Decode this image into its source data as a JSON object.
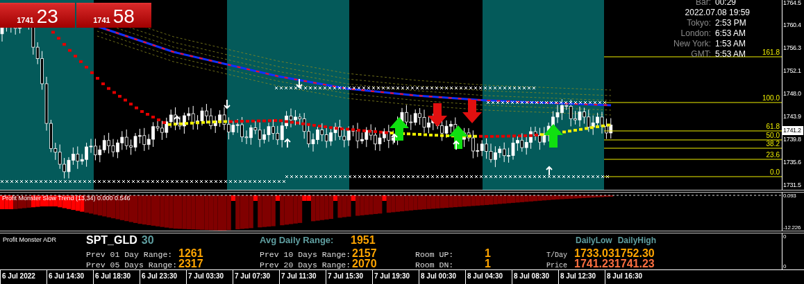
{
  "quote_boxes": [
    {
      "big_figure": "1741",
      "pips": "23"
    },
    {
      "big_figure": "1741",
      "pips": "58"
    }
  ],
  "info_panel": [
    {
      "label": "Bar:",
      "value": "00:29"
    },
    {
      "value": "2022.07.08 19:59"
    },
    {
      "label": "Tokyo:",
      "value": "2:53 PM"
    },
    {
      "label": "London:",
      "value": "6:53 AM"
    },
    {
      "label": "New York:",
      "value": "1:53 AM"
    },
    {
      "label": "GMT:",
      "value": "5:53 AM"
    }
  ],
  "fib_levels": [
    "161.8",
    "100.0",
    "61.8",
    "50.0",
    "38.2",
    "23.6",
    "0.0"
  ],
  "price_axis": [
    {
      "label": "1764.5",
      "highlighted": false
    },
    {
      "label": "1760.4",
      "highlighted": false
    },
    {
      "label": "1756.3",
      "highlighted": false
    },
    {
      "label": "1752.1",
      "highlighted": false
    },
    {
      "label": "1748.0",
      "highlighted": false
    },
    {
      "label": "1743.9",
      "highlighted": false
    },
    {
      "label": "1741.2",
      "highlighted": true
    },
    {
      "label": "1739.8",
      "highlighted": false
    },
    {
      "label": "1735.6",
      "highlighted": false
    },
    {
      "label": "1731.5",
      "highlighted": false
    }
  ],
  "indicator": {
    "title": "Profit Monster Slow Trend (13,34) 0.000 0.546",
    "axis_labels": [
      "0.093",
      "-12.226"
    ]
  },
  "adr_panel": {
    "title": "Profit Monster ADR",
    "symbol": "SPT_GLD",
    "timeframe": "30",
    "avg_label": "Avg Daily Range:",
    "avg_value": "1951",
    "rows": [
      {
        "label": "Prev 01 Day Range:",
        "value": "1261"
      },
      {
        "label": "Prev 05 Days Range:",
        "value": "2317"
      },
      {
        "label": "Prev 10 Days Range:",
        "value": "2157"
      },
      {
        "label": "Prev 20 Days Range:",
        "value": "2070"
      }
    ],
    "room": [
      {
        "label": "Room UP:",
        "value": "1"
      },
      {
        "label": "Room DN:",
        "value": "1"
      }
    ],
    "headers": [
      "DailyLow",
      "DailyHigh"
    ],
    "ranges": [
      {
        "label": "T/Day",
        "low": "1733.03",
        "high": "1752.30"
      },
      {
        "label": "Price",
        "low": "1741.23",
        "high": "1741.23"
      }
    ],
    "axis_labels": [
      "0",
      "0"
    ]
  },
  "time_axis": [
    "6 Jul 2022",
    "6 Jul 14:30",
    "6 Jul 18:30",
    "6 Jul 23:30",
    "7 Jul 03:30",
    "7 Jul 07:30",
    "7 Jul 11:30",
    "7 Jul 15:30",
    "7 Jul 19:30",
    "8 Jul 00:30",
    "8 Jul 04:30",
    "8 Jul 08:30",
    "8 Jul 12:30",
    "8 Jul 16:30"
  ]
}
